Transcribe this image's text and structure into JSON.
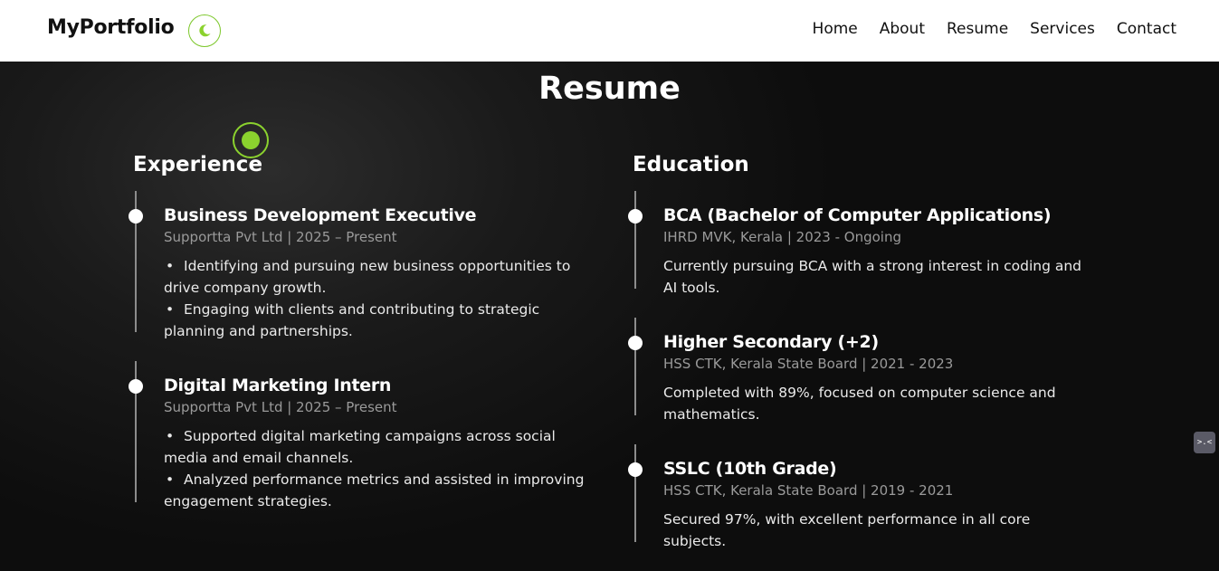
{
  "header": {
    "brand": "MyPortfolio",
    "theme_toggle_icon": "moon-icon",
    "nav": [
      "Home",
      "About",
      "Resume",
      "Services",
      "Contact"
    ]
  },
  "colors": {
    "accent": "#8bd22e",
    "background": "#0b0b0b"
  },
  "resume": {
    "title": "Resume",
    "experience": {
      "title": "Experience",
      "items": [
        {
          "role": "Business Development Executive",
          "meta": "Supportta Pvt Ltd | 2025 – Present",
          "bullets": [
            "Identifying and pursuing new business opportunities to drive company growth.",
            "Engaging with clients and contributing to strategic planning and partnerships."
          ]
        },
        {
          "role": "Digital Marketing Intern",
          "meta": "Supportta Pvt Ltd | 2025 – Present",
          "bullets": [
            "Supported digital marketing campaigns across social media and email channels.",
            "Analyzed performance metrics and assisted in improving engagement strategies."
          ]
        }
      ]
    },
    "education": {
      "title": "Education",
      "items": [
        {
          "degree": "BCA (Bachelor of Computer Applications)",
          "meta": "IHRD MVK, Kerala | 2023 - Ongoing",
          "desc": "Currently pursuing BCA with a strong interest in coding and AI tools."
        },
        {
          "degree": "Higher Secondary (+2)",
          "meta": "HSS CTK, Kerala State Board | 2021 - 2023",
          "desc": "Completed with 89%, focused on computer science and mathematics."
        },
        {
          "degree": "SSLC (10th Grade)",
          "meta": "HSS CTK, Kerala State Board | 2019 - 2021",
          "desc": "Secured 97%, with excellent performance in all core subjects."
        }
      ]
    }
  },
  "widget": {
    "label": ">.<"
  }
}
